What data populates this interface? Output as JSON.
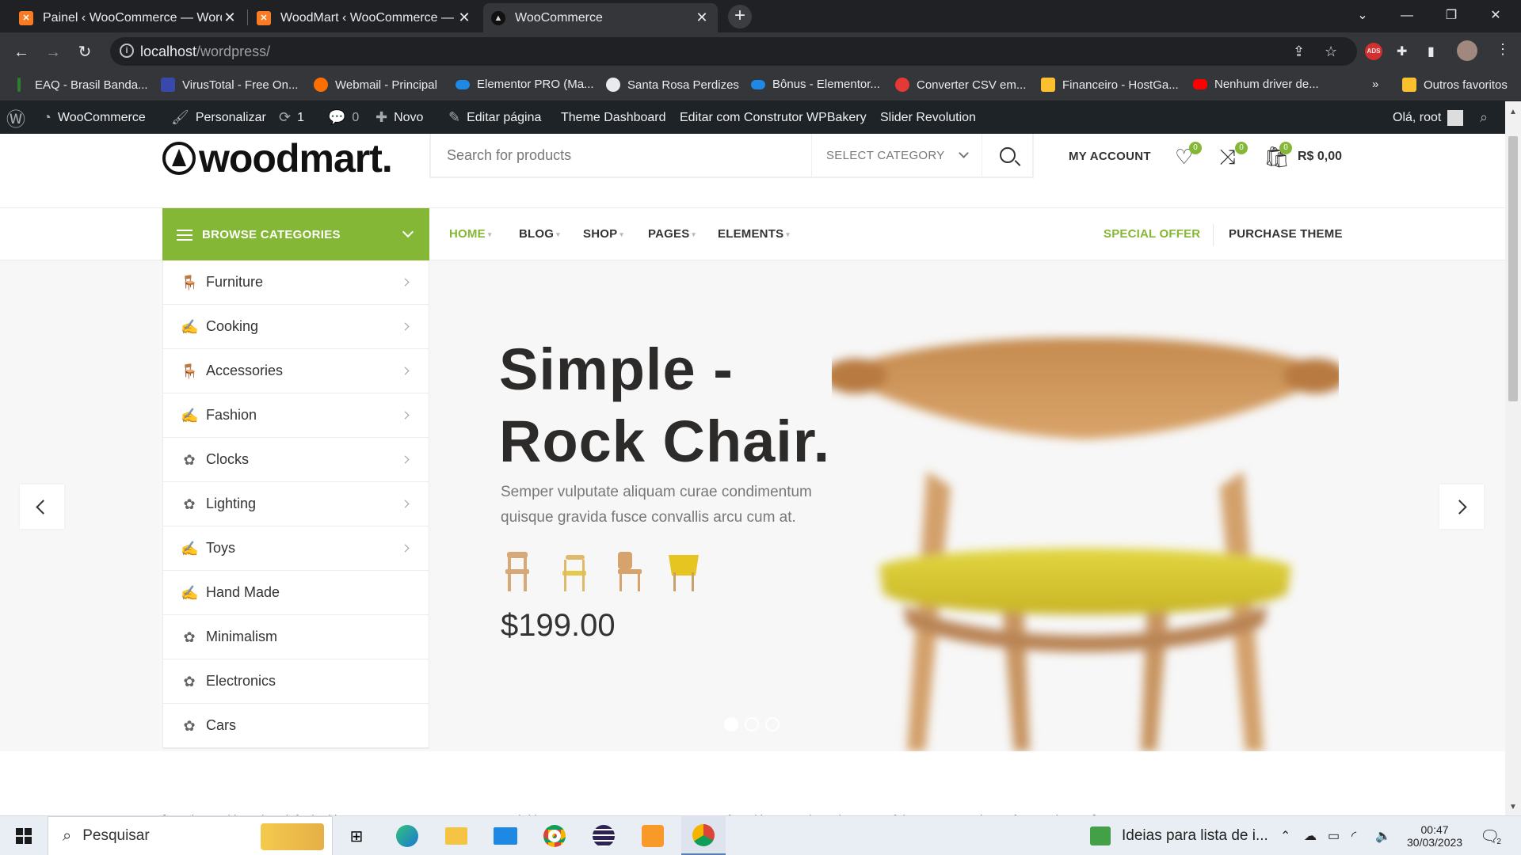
{
  "browser": {
    "tabs": [
      {
        "title": "Painel ‹ WooCommerce — WordPress",
        "favicon": "xampp-icon",
        "active": false
      },
      {
        "title": "WoodMart ‹ WooCommerce — W",
        "favicon": "xampp-icon",
        "active": false
      },
      {
        "title": "WooCommerce",
        "favicon": "woodmart-icon",
        "active": true
      }
    ],
    "url_host": "localhost",
    "url_path": "/wordpress/",
    "bookmarks": [
      {
        "label": "EAQ - Brasil Banda...",
        "color": "#2e7d32"
      },
      {
        "label": "VirusTotal - Free On...",
        "color": "#3949ab"
      },
      {
        "label": "Webmail - Principal",
        "color": "#ff6f00"
      },
      {
        "label": "Elementor PRO (Ma...",
        "color": "#1e88e5"
      },
      {
        "label": "Santa Rosa Perdizes",
        "color": "#e8eaed"
      },
      {
        "label": "Bônus - Elementor...",
        "color": "#1e88e5"
      },
      {
        "label": "Converter CSV em...",
        "color": "#e53935"
      },
      {
        "label": "Financeiro - HostGa...",
        "color": "#fbc02d"
      },
      {
        "label": "Nenhum driver de...",
        "color": "#ff0000"
      }
    ],
    "bookmarks_more": "»",
    "other_bookmarks": "Outros favoritos"
  },
  "wp_admin_bar": {
    "site": "WooCommerce",
    "customize": "Personalizar",
    "updates": "1",
    "comments": "0",
    "new": "Novo",
    "edit_page": "Editar página",
    "theme_dashboard": "Theme Dashboard",
    "wpbakery": "Editar com Construtor WPBakery",
    "slider": "Slider Revolution",
    "greeting": "Olá, root"
  },
  "header": {
    "logo": "woodmart.",
    "search_placeholder": "Search for products",
    "select_category": "SELECT CATEGORY",
    "my_account": "MY ACCOUNT",
    "wishlist_count": "0",
    "compare_count": "0",
    "cart_count": "0",
    "cart_total": "R$ 0,00"
  },
  "nav": {
    "browse_categories": "BROWSE CATEGORIES",
    "menu": [
      "HOME",
      "BLOG",
      "SHOP",
      "PAGES",
      "ELEMENTS"
    ],
    "special_offer": "SPECIAL OFFER",
    "purchase_theme": "PURCHASE THEME",
    "accent_color": "#83b735"
  },
  "categories": [
    {
      "label": "Furniture",
      "icon": "chair-icon",
      "has_sub": true
    },
    {
      "label": "Cooking",
      "icon": "cooking-icon",
      "has_sub": true
    },
    {
      "label": "Accessories",
      "icon": "chair-icon",
      "has_sub": true
    },
    {
      "label": "Fashion",
      "icon": "cooking-icon",
      "has_sub": true
    },
    {
      "label": "Clocks",
      "icon": "plant-icon",
      "has_sub": true
    },
    {
      "label": "Lighting",
      "icon": "plant-icon",
      "has_sub": true
    },
    {
      "label": "Toys",
      "icon": "cooking-icon",
      "has_sub": true
    },
    {
      "label": "Hand Made",
      "icon": "cooking-icon",
      "has_sub": false
    },
    {
      "label": "Minimalism",
      "icon": "plant-icon",
      "has_sub": false
    },
    {
      "label": "Electronics",
      "icon": "plant-icon",
      "has_sub": false
    },
    {
      "label": "Cars",
      "icon": "plant-icon",
      "has_sub": false
    }
  ],
  "slide": {
    "title_line1": "Simple -",
    "title_line2": "Rock Chair.",
    "description": "Semper vulputate aliquam curae condimentum quisque gravida fusce convallis arcu cum at.",
    "price": "$199.00",
    "active_dot": 1
  },
  "below_text": "[woodmart_title style=\"default\" title=\"FEATURED CATEGORIES\" subtitle=\"WOODMART COLLECTIONS\" after_title=\"WoodMart is a powerful eCommerce theme for WordPress\"]",
  "taskbar": {
    "search": "Pesquisar",
    "news": "Ideias para lista de i...",
    "time": "00:47",
    "date": "30/03/2023",
    "notifications": "2"
  }
}
